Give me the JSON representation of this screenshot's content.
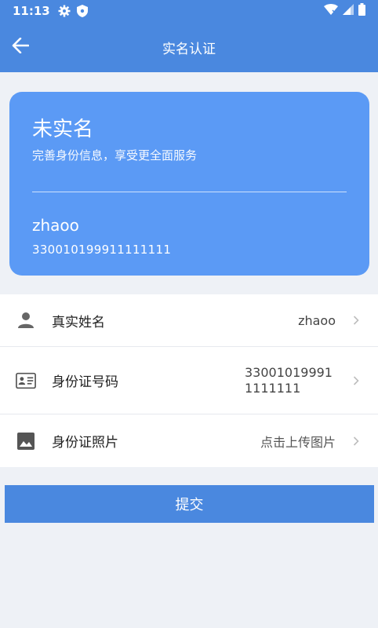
{
  "status_bar": {
    "time": "11:13"
  },
  "app_bar": {
    "title": "实名认证"
  },
  "card": {
    "status": "未实名",
    "subtitle": "完善身份信息，享受更全面服务",
    "username": "zhaoo",
    "id_number": "330010199911111111"
  },
  "fields": [
    {
      "label": "真实姓名",
      "value": "zhaoo",
      "icon": "person-icon"
    },
    {
      "label": "身份证号码",
      "value": "330010199911111111",
      "icon": "id-card-icon"
    },
    {
      "label": "身份证照片",
      "value": "点击上传图片",
      "icon": "image-icon"
    }
  ],
  "submit_label": "提交",
  "colors": {
    "primary": "#4a88df",
    "card": "#5b9af5",
    "background": "#eef1f6"
  }
}
